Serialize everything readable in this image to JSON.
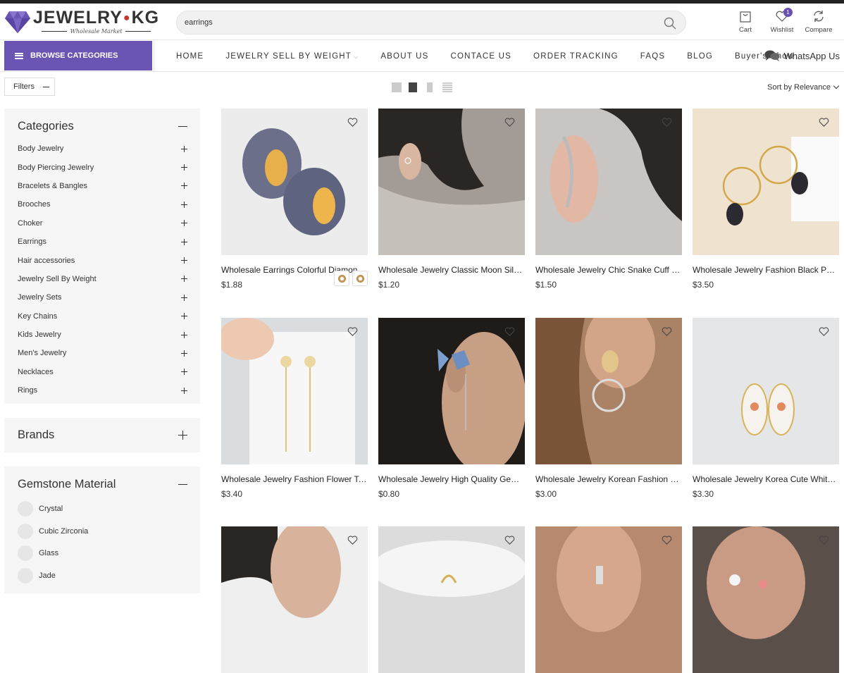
{
  "brand": {
    "name_left": "JEWELRY",
    "name_right": "KG",
    "tagline": "Wholesale Market"
  },
  "search": {
    "value": "earrings"
  },
  "header_actions": [
    {
      "label": "Cart",
      "icon": "bag-icon"
    },
    {
      "label": "Wishlist",
      "icon": "heart-icon",
      "badge": "1"
    },
    {
      "label": "Compare",
      "icon": "refresh-icon"
    }
  ],
  "nav": {
    "browse_label": "BROWSE CATEGORIES",
    "items": [
      "HOME",
      "JEWELRY SELL BY WEIGHT",
      "ABOUT US",
      "CONTACE US",
      "ORDER TRACKING",
      "FAQS",
      "BLOG",
      "Buyer's Show"
    ],
    "whatsapp": "WhatsApp Us"
  },
  "toolbar": {
    "filters_label": "Filters",
    "sort_label": "Sort by Relevance"
  },
  "sidebar": {
    "categories_title": "Categories",
    "categories": [
      "Body Jewelry",
      "Body Piercing Jewelry",
      "Bracelets & Bangles",
      "Brooches",
      "Choker",
      "Earrings",
      "Hair accessories",
      "Jewelry Sell By Weight",
      "Jewelry Sets",
      "Key Chains",
      "Kids Jewelry",
      "Men's Jewelry",
      "Necklaces",
      "Rings"
    ],
    "brands_title": "Brands",
    "gemstone_title": "Gemstone Material",
    "gemstones": [
      "Crystal",
      "Cubic Zirconia",
      "Glass",
      "Jade"
    ]
  },
  "products": [
    {
      "title": "Wholesale Earrings Colorful Diamond Pearl C-Shaped Earrings",
      "price": "$1.88"
    },
    {
      "title": "Wholesale Jewelry Classic Moon Silver Earrings",
      "price": "$1.20"
    },
    {
      "title": "Wholesale Jewelry Chic Snake Cuff Earrings",
      "price": "$1.50"
    },
    {
      "title": "Wholesale Jewelry Fashion Black Pearl Earrings",
      "price": "$3.50"
    },
    {
      "title": "Wholesale Jewelry Fashion Flower Tassel Earrings",
      "price": "$3.40"
    },
    {
      "title": "Wholesale Jewelry High Quality Gem Butterfly Earrings",
      "price": "$0.80"
    },
    {
      "title": "Wholesale Jewelry Korean Fashion Circle Earrings",
      "price": "$3.00"
    },
    {
      "title": "Wholesale Jewelry Korea Cute White Tulip Earrings",
      "price": "$3.30"
    },
    {
      "title": "",
      "price": ""
    },
    {
      "title": "",
      "price": ""
    },
    {
      "title": "",
      "price": ""
    },
    {
      "title": "",
      "price": ""
    }
  ]
}
